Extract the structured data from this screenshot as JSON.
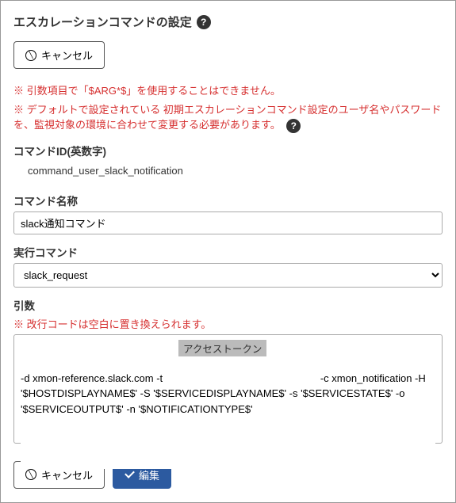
{
  "header": {
    "title": "エスカレーションコマンドの設定"
  },
  "buttons": {
    "cancel": "キャンセル",
    "edit": "編集"
  },
  "warnings": {
    "line1": "※ 引数項目で「$ARG*$」を使用することはできません。",
    "line2": "※ デフォルトで設定されている 初期エスカレーションコマンド設定のユーザ名やパスワードを、監視対象の環境に合わせて変更する必要があります。"
  },
  "fields": {
    "command_id": {
      "label": "コマンドID(英数字)",
      "value": "command_user_slack_notification"
    },
    "command_name": {
      "label": "コマンド名称",
      "value": "slack通知コマンド"
    },
    "exec_command": {
      "label": "実行コマンド",
      "value": "slack_request"
    },
    "arguments": {
      "label": "引数",
      "note": "※ 改行コードは空白に置き換えられます。",
      "value": "-d xmon-reference.slack.com -t                                                       -c xmon_notification -H '$HOSTDISPLAYNAME$' -S '$SERVICEDISPLAYNAME$' -s '$SERVICESTATE$' -o '$SERVICEOUTPUT$' -n '$NOTIFICATIONTYPE$'",
      "highlight": "アクセストークン"
    }
  }
}
